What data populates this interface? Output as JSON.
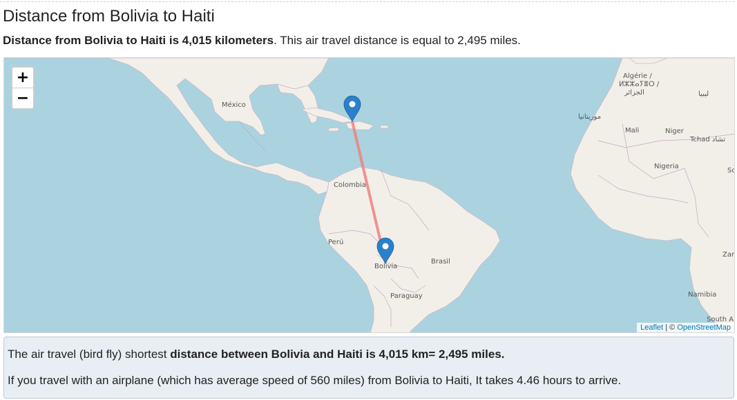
{
  "page_title": "Distance from Bolivia to Haiti",
  "lead": {
    "bold": "Distance from Bolivia to Haiti is 4,015 kilometers",
    "rest": ". This air travel distance is equal to 2,495 miles."
  },
  "map": {
    "zoom_in": "+",
    "zoom_out": "−",
    "attribution": {
      "leaflet": "Leaflet",
      "separator": " | © ",
      "osm": "OpenStreetMap"
    },
    "labels": {
      "mexico": "México",
      "colombia": "Colombia",
      "peru": "Perú",
      "bolivia": "Bolivia",
      "brasil": "Brasil",
      "paraguay": "Paraguay",
      "algeria_1": "Algérie /",
      "algeria_2": "ⵍⵣⵣⴰⵢⴻⵔ /",
      "algeria_3": "الجزائر",
      "libya": "ليبيا",
      "mauritania": "موريتانيا",
      "mali": "Mali",
      "niger": "Niger",
      "chad": "Tchad تشاد",
      "nigeria": "Nigeria",
      "so": "So",
      "zambia": "Zan",
      "namibia": "Namibia",
      "south_africa": "South A"
    },
    "markers": {
      "origin": "Bolivia",
      "destination": "Haiti"
    },
    "route_color": "#f08080",
    "marker_color": "#2a81cb"
  },
  "info": {
    "p1_text": "The air travel (bird fly) shortest ",
    "p1_bold": "distance between Bolivia and Haiti is 4,015 km= 2,495 miles.",
    "p2": "If you travel with an airplane (which has average speed of 560 miles) from Bolivia to Haiti, It takes 4.46 hours to arrive."
  }
}
